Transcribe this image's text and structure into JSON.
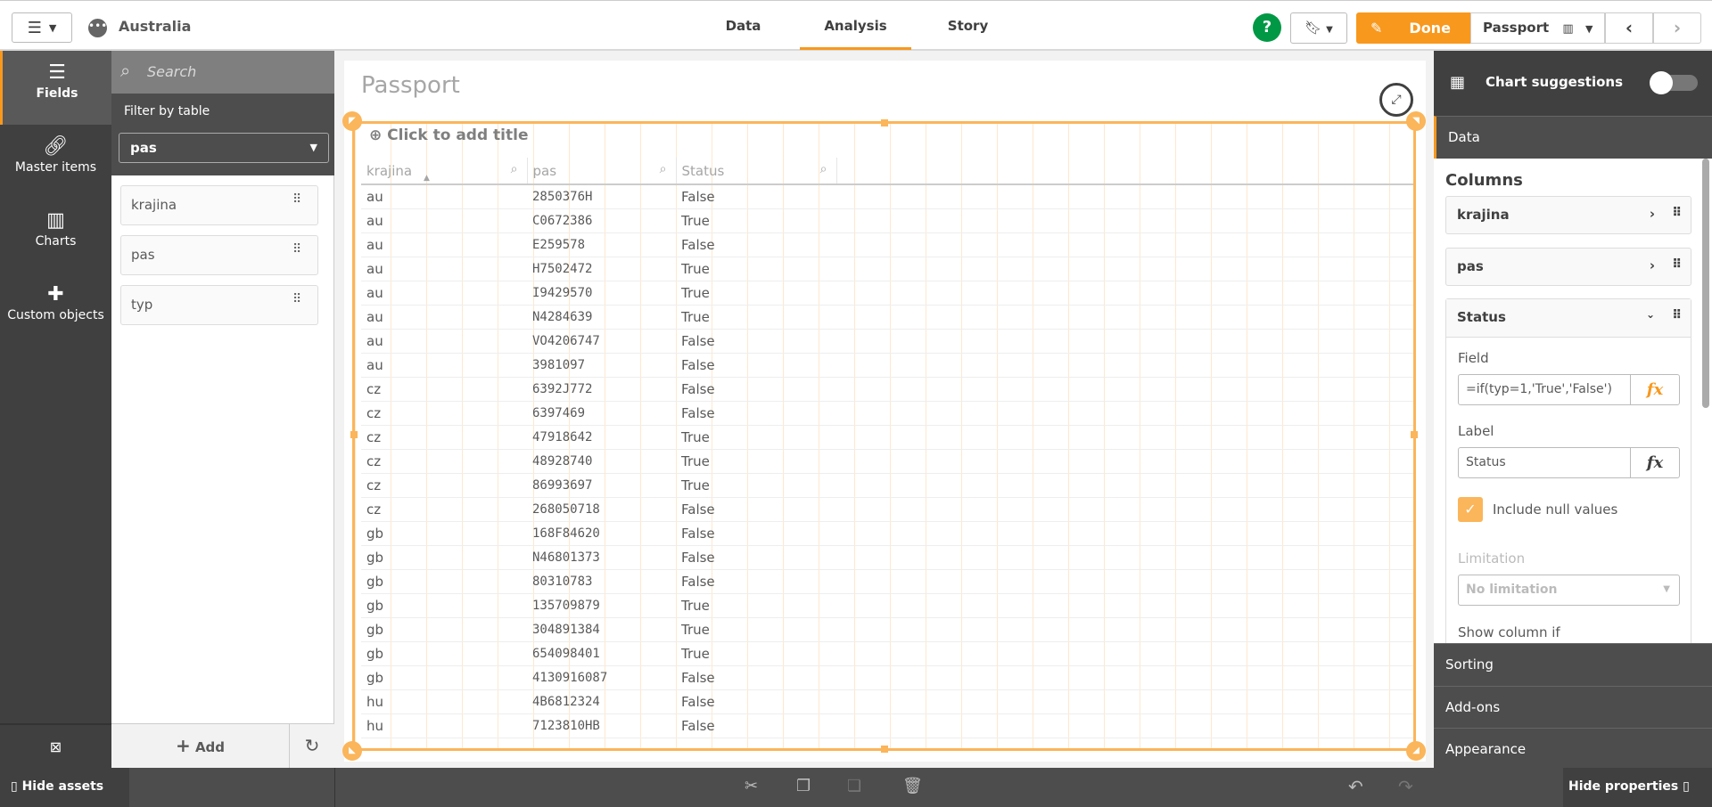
{
  "topbar": {
    "app_name": "Australia",
    "tabs": [
      "Data",
      "Analysis",
      "Story"
    ],
    "active_tab": "Analysis",
    "help": "?",
    "done_label": "Done",
    "sheet_name": "Passport"
  },
  "rail": {
    "items": [
      "Fields",
      "Master items",
      "Charts",
      "Custom objects"
    ]
  },
  "assets": {
    "search_placeholder": "Search",
    "filter_label": "Filter by table",
    "filter_value": "pas",
    "fields": [
      "krajina",
      "pas",
      "typ"
    ],
    "add_label": "Add"
  },
  "sheet": {
    "title": "Passport",
    "object_title_placeholder": "Click to add title"
  },
  "table": {
    "columns": [
      "krajina",
      "pas",
      "Status"
    ],
    "rows": [
      [
        "au",
        "2850376H",
        "False"
      ],
      [
        "au",
        "C0672386",
        "True"
      ],
      [
        "au",
        "E259578",
        "False"
      ],
      [
        "au",
        "H7502472",
        "True"
      ],
      [
        "au",
        "I9429570",
        "True"
      ],
      [
        "au",
        "N4284639",
        "True"
      ],
      [
        "au",
        "VO4206747",
        "False"
      ],
      [
        "au",
        "3981097",
        "False"
      ],
      [
        "cz",
        "6392J772",
        "False"
      ],
      [
        "cz",
        "6397469",
        "False"
      ],
      [
        "cz",
        "47918642",
        "True"
      ],
      [
        "cz",
        "48928740",
        "True"
      ],
      [
        "cz",
        "86993697",
        "True"
      ],
      [
        "cz",
        "268050718",
        "False"
      ],
      [
        "gb",
        "168F84620",
        "False"
      ],
      [
        "gb",
        "N46801373",
        "False"
      ],
      [
        "gb",
        "80310783",
        "False"
      ],
      [
        "gb",
        "135709879",
        "True"
      ],
      [
        "gb",
        "304891384",
        "True"
      ],
      [
        "gb",
        "654098401",
        "True"
      ],
      [
        "gb",
        "4130916087",
        "False"
      ],
      [
        "hu",
        "4B6812324",
        "False"
      ],
      [
        "hu",
        "7123810HB",
        "False"
      ]
    ]
  },
  "props": {
    "chart_suggestions": "Chart suggestions",
    "data": "Data",
    "columns_heading": "Columns",
    "columns": [
      "krajina",
      "pas",
      "Status"
    ],
    "field_label": "Field",
    "field_value": "=if(typ=1,'True','False')",
    "label_label": "Label",
    "label_value": "Status",
    "fx": "fx",
    "include_null": "Include null values",
    "limitation_label": "Limitation",
    "limitation_value": "No limitation",
    "show_column_if": "Show column if",
    "sections": [
      "Sorting",
      "Add-ons",
      "Appearance"
    ]
  },
  "bottombar": {
    "hide_assets": "Hide assets",
    "hide_properties": "Hide properties"
  },
  "colors": {
    "accent": "#f8981d",
    "help": "#009845",
    "frame": "#fbb55a"
  }
}
